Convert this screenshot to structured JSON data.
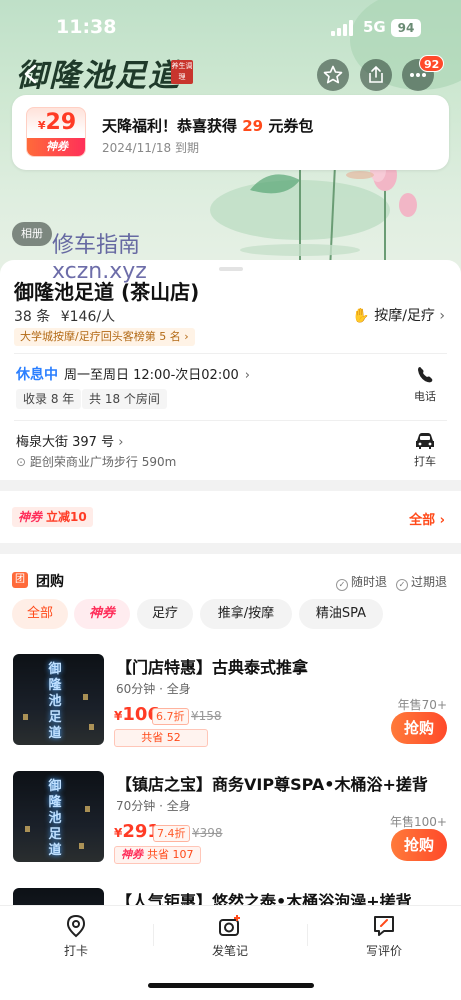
{
  "status_bar": {
    "time": "11:38",
    "network": "5G",
    "battery": "94"
  },
  "header": {
    "brand_logo_text": "御隆池足道",
    "brand_seal_text": "养生调理",
    "notification_count": "92"
  },
  "coupon": {
    "amount_symbol": "¥",
    "amount": "29",
    "tag": "神券",
    "title_prefix": "天降福利！恭喜获得 ",
    "title_highlight": "29",
    "title_suffix": " 元券包",
    "expiry": "2024/11/18 到期"
  },
  "album_label": "相册",
  "watermark": {
    "line1": "修车指南",
    "line2": "xczn.xyz"
  },
  "shop": {
    "name": "御隆池足道 (茶山店)",
    "reviews": "38 条",
    "price_per_person": "¥146/人",
    "category": "按摩/足疗",
    "rank": "大学城按摩/足疗回头客榜第 5 名",
    "open_status": "休息中",
    "hours": "周一至周日 12:00-次日02:00",
    "tags": [
      "收录 8 年",
      "共 18 个房间"
    ],
    "phone_label": "电话",
    "address": "梅泉大街 397 号",
    "distance": "距创荣商业广场步行 590m",
    "taxi_label": "打车"
  },
  "promo": {
    "tag": "神券",
    "text": "立减10",
    "all_label": "全部"
  },
  "group_buy": {
    "title": "团购",
    "icon_text": "团",
    "policies": [
      "随时退",
      "过期退"
    ],
    "filters": [
      "全部",
      "神券",
      "足疗",
      "推拿/按摩",
      "精油SPA"
    ],
    "deals": [
      {
        "title": "【门店特惠】古典泰式推拿",
        "meta": "60分钟 · 全身",
        "price": "106",
        "discount": "6.7折",
        "original": "¥158",
        "saving": "共省 52",
        "saving_tag": "",
        "sold": "年售70+",
        "buy_label": "抢购"
      },
      {
        "title": "【镇店之宝】商务VIP尊SPA•木桶浴+搓背",
        "meta": "70分钟 · 全身",
        "price": "291",
        "discount": "7.4折",
        "original": "¥398",
        "saving": "共省 107",
        "saving_tag": "神券",
        "sold": "年售100+",
        "buy_label": "抢购"
      },
      {
        "title": "【人气钜惠】悠然之泰•木桶浴泡澡+搓背",
        "meta": "",
        "price": "",
        "discount": "",
        "original": "",
        "saving": "",
        "saving_tag": "",
        "sold": "",
        "buy_label": ""
      }
    ],
    "shop_sign_text": "御隆池足道"
  },
  "bottom_bar": {
    "checkin": "打卡",
    "post_note": "发笔记",
    "write_review": "写评价"
  },
  "colors": {
    "accent": "#ff4a1a",
    "blue_status": "#2b7fff",
    "hero_green": "#cfe8d2"
  }
}
